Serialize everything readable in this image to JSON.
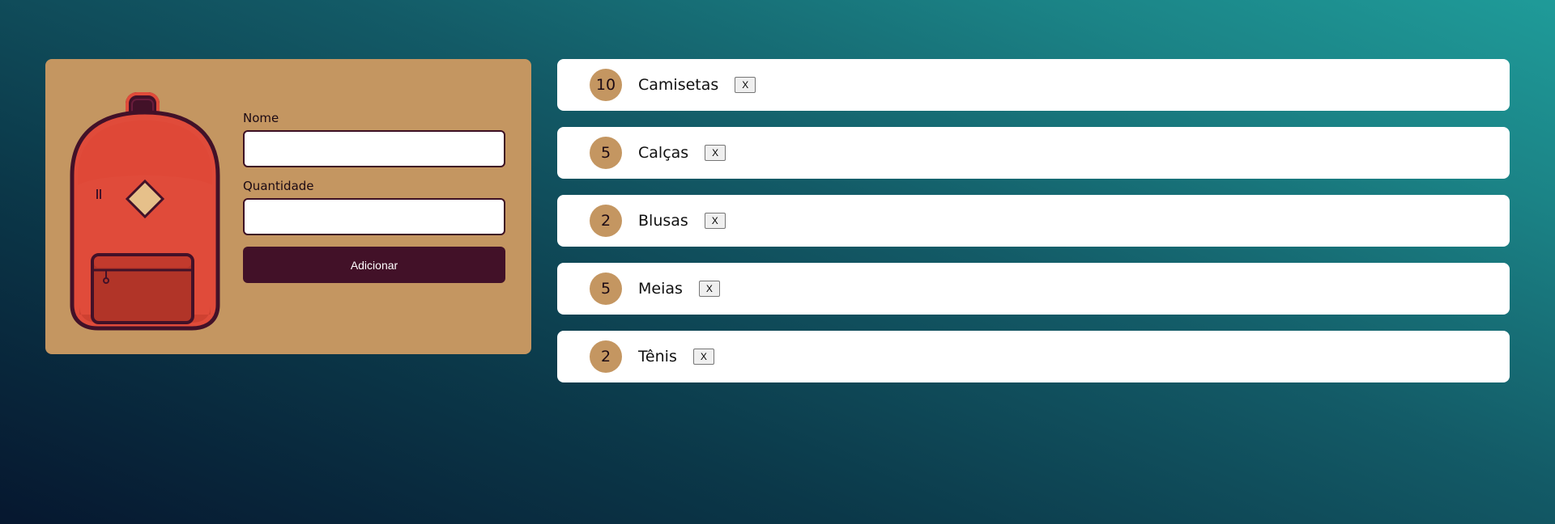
{
  "form": {
    "name_label": "Nome",
    "name_value": "",
    "quantity_label": "Quantidade",
    "quantity_value": "",
    "submit_label": "Adicionar"
  },
  "items": [
    {
      "quantity": "10",
      "name": "Camisetas",
      "remove_label": "X"
    },
    {
      "quantity": "5",
      "name": "Calças",
      "remove_label": "X"
    },
    {
      "quantity": "2",
      "name": "Blusas",
      "remove_label": "X"
    },
    {
      "quantity": "5",
      "name": "Meias",
      "remove_label": "X"
    },
    {
      "quantity": "2",
      "name": "Tênis",
      "remove_label": "X"
    }
  ],
  "icons": {
    "illustration": "backpack-icon"
  },
  "colors": {
    "card_background": "#c49661",
    "button_background": "#421128",
    "backpack_body": "#e04b3a",
    "badge_background": "#c49661"
  }
}
